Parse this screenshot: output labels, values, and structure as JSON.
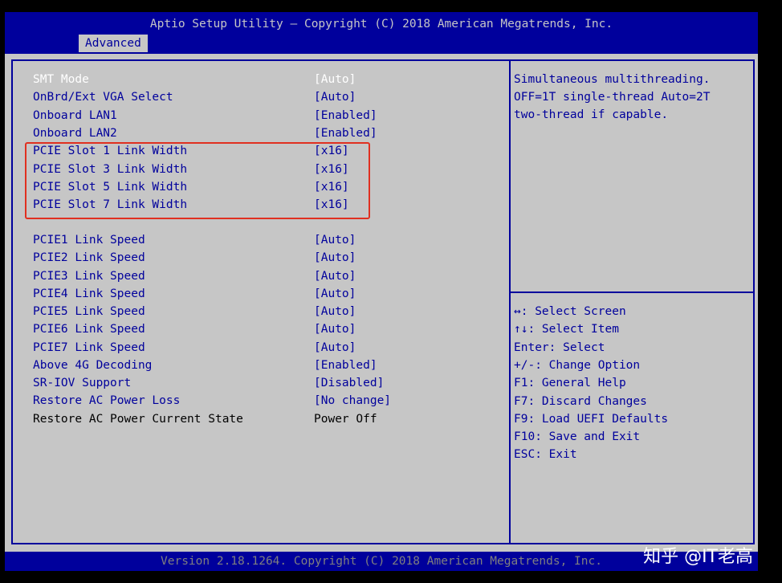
{
  "header": {
    "title": "Aptio Setup Utility – Copyright (C) 2018 American Megatrends, Inc.",
    "active_tab": "Advanced"
  },
  "settings": [
    {
      "label": "SMT Mode",
      "value": "[Auto]",
      "state": "selected"
    },
    {
      "label": "OnBrd/Ext VGA Select",
      "value": "[Auto]",
      "state": "normal"
    },
    {
      "label": "Onboard LAN1",
      "value": "[Enabled]",
      "state": "normal"
    },
    {
      "label": "Onboard LAN2",
      "value": "[Enabled]",
      "state": "normal"
    },
    {
      "label": "PCIE Slot 1 Link Width",
      "value": "[x16]",
      "state": "normal"
    },
    {
      "label": "PCIE Slot 3 Link Width",
      "value": "[x16]",
      "state": "normal"
    },
    {
      "label": "PCIE Slot 5 Link Width",
      "value": "[x16]",
      "state": "normal"
    },
    {
      "label": "PCIE Slot 7 Link Width",
      "value": "[x16]",
      "state": "normal"
    },
    {
      "label": "PCIE1 Link Speed",
      "value": "[Auto]",
      "state": "normal"
    },
    {
      "label": "PCIE2 Link Speed",
      "value": "[Auto]",
      "state": "normal"
    },
    {
      "label": "PCIE3 Link Speed",
      "value": "[Auto]",
      "state": "normal"
    },
    {
      "label": "PCIE4 Link Speed",
      "value": "[Auto]",
      "state": "normal"
    },
    {
      "label": "PCIE5 Link Speed",
      "value": "[Auto]",
      "state": "normal"
    },
    {
      "label": "PCIE6 Link Speed",
      "value": "[Auto]",
      "state": "normal"
    },
    {
      "label": "PCIE7 Link Speed",
      "value": "[Auto]",
      "state": "normal"
    },
    {
      "label": "Above 4G Decoding",
      "value": "[Enabled]",
      "state": "normal"
    },
    {
      "label": "SR-IOV Support",
      "value": "[Disabled]",
      "state": "normal"
    },
    {
      "label": "Restore AC Power Loss",
      "value": "[No change]",
      "state": "normal"
    },
    {
      "label": "Restore AC Power Current State",
      "value": "Power Off",
      "state": "readonly"
    }
  ],
  "help_text": [
    "Simultaneous multithreading.",
    "OFF=1T single-thread Auto=2T",
    "two-thread if capable."
  ],
  "key_legend": [
    "↔: Select Screen",
    "↑↓: Select Item",
    "Enter: Select",
    "+/-: Change Option",
    "F1: General Help",
    "F7: Discard Changes",
    "F9: Load UEFI Defaults",
    "F10: Save and Exit",
    "ESC: Exit"
  ],
  "footer": {
    "version": "Version 2.18.1264. Copyright (C) 2018 American Megatrends, Inc.",
    "watermark": "知乎 @IT老高"
  },
  "colors": {
    "bios_blue": "#00009c",
    "bios_gray": "#c6c6c6",
    "highlight": "#ffffff",
    "annotation_red": "#e03020"
  }
}
